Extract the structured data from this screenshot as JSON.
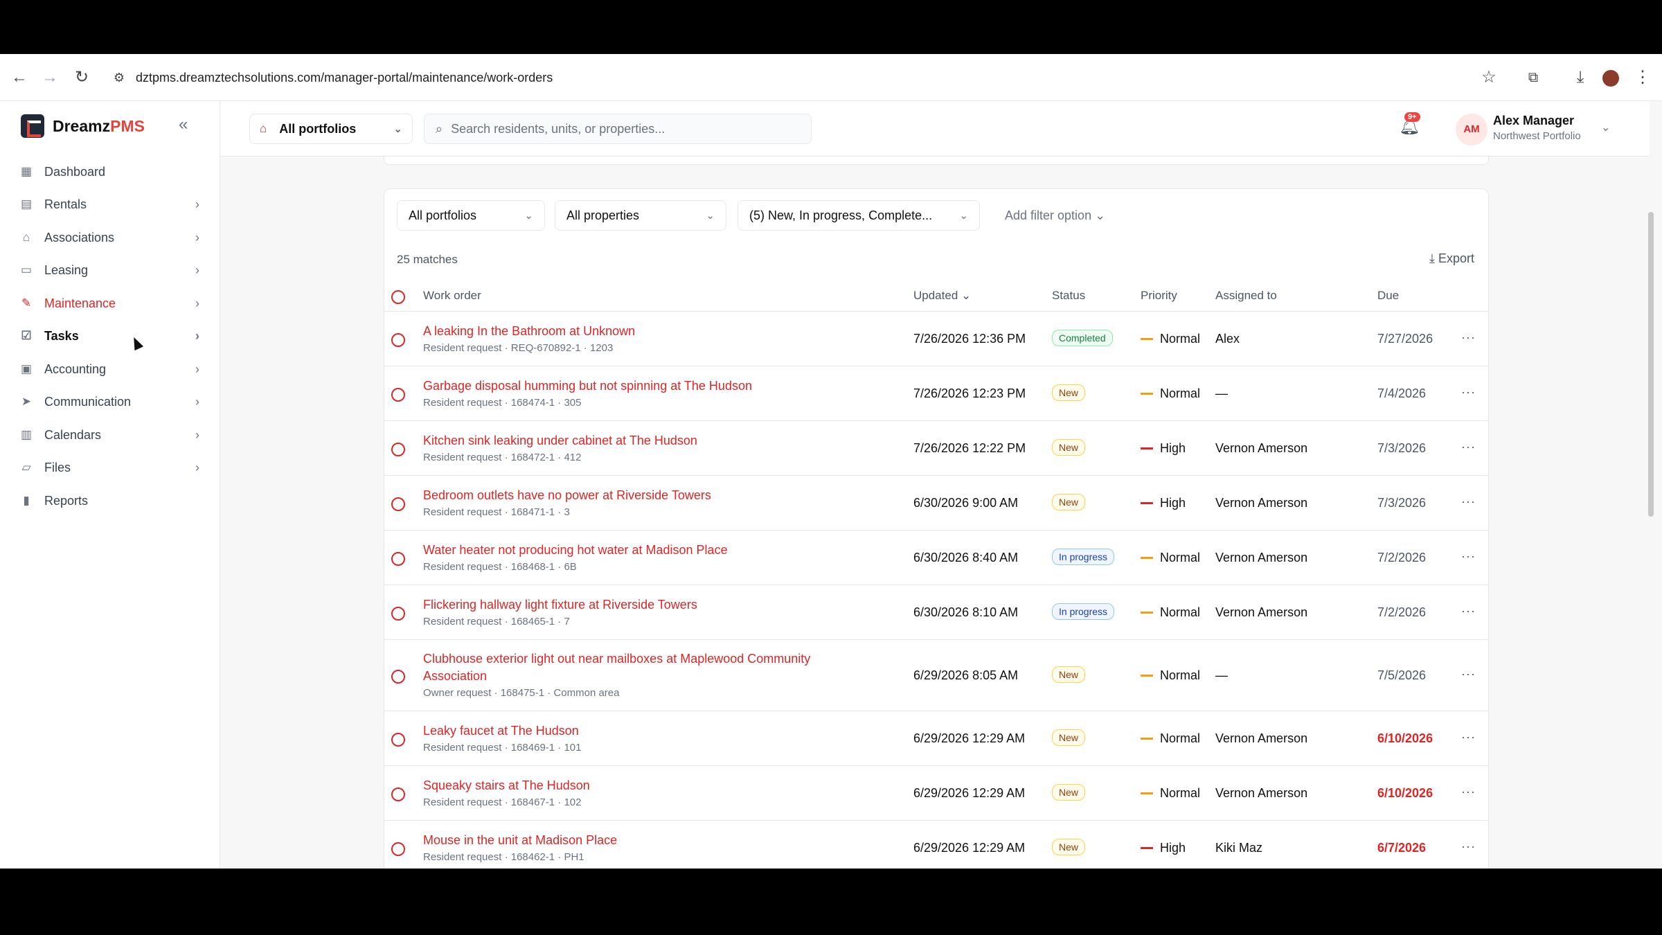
{
  "browser": {
    "url": "dztpms.dreamztechsolutions.com/manager-portal/maintenance/work-orders"
  },
  "app": {
    "brand_main": "Dreamz",
    "brand_accent": "PMS"
  },
  "sidebar": {
    "items": [
      {
        "label": "Dashboard",
        "icon": "grid-icon",
        "chevron": false
      },
      {
        "label": "Rentals",
        "icon": "building-icon",
        "chevron": true
      },
      {
        "label": "Associations",
        "icon": "bank-icon",
        "chevron": true
      },
      {
        "label": "Leasing",
        "icon": "document-icon",
        "chevron": true
      },
      {
        "label": "Maintenance",
        "icon": "wrench-icon",
        "chevron": true
      },
      {
        "label": "Tasks",
        "icon": "checkbox-icon",
        "chevron": true
      },
      {
        "label": "Accounting",
        "icon": "wallet-icon",
        "chevron": true
      },
      {
        "label": "Communication",
        "icon": "send-icon",
        "chevron": true
      },
      {
        "label": "Calendars",
        "icon": "calendar-icon",
        "chevron": true
      },
      {
        "label": "Files",
        "icon": "folder-icon",
        "chevron": true
      },
      {
        "label": "Reports",
        "icon": "bar-chart-icon",
        "chevron": false
      }
    ]
  },
  "header": {
    "portfolio_select": "All portfolios",
    "search_placeholder": "Search residents, units, or properties...",
    "notification_badge": "9+",
    "user_initials": "AM",
    "user_name": "Alex Manager",
    "user_portfolio": "Northwest Portfolio"
  },
  "filters": {
    "portfolios": "All portfolios",
    "properties": "All properties",
    "status": "(5) New, In progress, Complete...",
    "add_filter": "Add filter option"
  },
  "results": {
    "matches": "25 matches",
    "export": "Export"
  },
  "table": {
    "headers": {
      "work_order": "Work order",
      "updated": "Updated",
      "status": "Status",
      "priority": "Priority",
      "assigned": "Assigned to",
      "due": "Due"
    },
    "rows": [
      {
        "title": "A leaking In the Bathroom at Unknown",
        "title2": "",
        "sub": "Resident request · REQ-670892-1 · 1203",
        "updated": "7/26/2026 12:36 PM",
        "status": "Completed",
        "priority": "Normal",
        "assigned": "Alex",
        "due": "7/27/2026"
      },
      {
        "title": "Garbage disposal humming but not spinning at The Hudson",
        "title2": "",
        "sub": "Resident request · 168474-1 · 305",
        "updated": "7/26/2026 12:23 PM",
        "status": "New",
        "priority": "Normal",
        "assigned": "—",
        "due": "7/4/2026"
      },
      {
        "title": "Kitchen sink leaking under cabinet at The Hudson",
        "title2": "",
        "sub": "Resident request · 168472-1 · 412",
        "updated": "7/26/2026 12:22 PM",
        "status": "New",
        "priority": "High",
        "assigned": "Vernon Amerson",
        "due": "7/3/2026"
      },
      {
        "title": "Bedroom outlets have no power at Riverside Towers",
        "title2": "",
        "sub": "Resident request · 168471-1 · 3",
        "updated": "6/30/2026 9:00 AM",
        "status": "New",
        "priority": "High",
        "assigned": "Vernon Amerson",
        "due": "7/3/2026"
      },
      {
        "title": "Water heater not producing hot water at Madison Place",
        "title2": "",
        "sub": "Resident request · 168468-1 · 6B",
        "updated": "6/30/2026 8:40 AM",
        "status": "In progress",
        "priority": "Normal",
        "assigned": "Vernon Amerson",
        "due": "7/2/2026"
      },
      {
        "title": "Flickering hallway light fixture at Riverside Towers",
        "title2": "",
        "sub": "Resident request · 168465-1 · 7",
        "updated": "6/30/2026 8:10 AM",
        "status": "In progress",
        "priority": "Normal",
        "assigned": "Vernon Amerson",
        "due": "7/2/2026"
      },
      {
        "title": "Clubhouse exterior light out near mailboxes at Maplewood Community",
        "title2": "Association",
        "sub": "Owner request · 168475-1 · Common area",
        "updated": "6/29/2026 8:05 AM",
        "status": "New",
        "priority": "Normal",
        "assigned": "—",
        "due": "7/5/2026"
      },
      {
        "title": "Leaky faucet at The Hudson",
        "title2": "",
        "sub": "Resident request · 168469-1 · 101",
        "updated": "6/29/2026 12:29 AM",
        "status": "New",
        "priority": "Normal",
        "assigned": "Vernon Amerson",
        "due": "6/10/2026"
      },
      {
        "title": "Squeaky stairs at The Hudson",
        "title2": "",
        "sub": "Resident request · 168467-1 · 102",
        "updated": "6/29/2026 12:29 AM",
        "status": "New",
        "priority": "Normal",
        "assigned": "Vernon Amerson",
        "due": "6/10/2026"
      },
      {
        "title": "Mouse in the unit at Madison Place",
        "title2": "",
        "sub": "Resident request · 168462-1 · PH1",
        "updated": "6/29/2026 12:29 AM",
        "status": "New",
        "priority": "High",
        "assigned": "Kiki Maz",
        "due": "6/7/2026"
      }
    ]
  },
  "colors": {
    "accent": "#dc2626",
    "priority_normal": "#f59e0b",
    "priority_high": "#dc2626"
  }
}
